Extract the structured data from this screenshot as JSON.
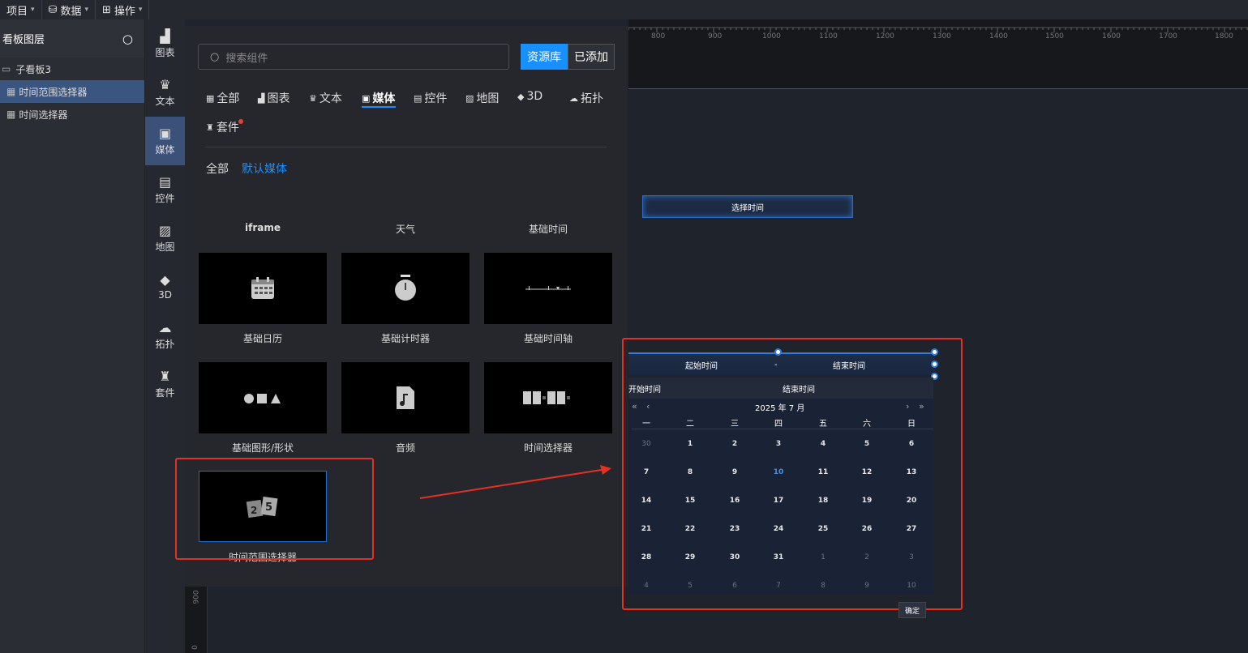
{
  "menu": [
    {
      "label": "项目",
      "icon": "none"
    },
    {
      "label": "数据",
      "icon": "database-icon"
    },
    {
      "label": "操作",
      "icon": "grid-icon"
    }
  ],
  "layers": {
    "title": "看板图层",
    "board": "子看板3",
    "items": [
      {
        "label": "时间范围选择器",
        "selected": true
      },
      {
        "label": "时间选择器",
        "selected": false
      }
    ]
  },
  "categories": [
    {
      "label": "图表",
      "icon": "chart-icon"
    },
    {
      "label": "文本",
      "icon": "crown-icon"
    },
    {
      "label": "媒体",
      "icon": "media-icon",
      "active": true
    },
    {
      "label": "控件",
      "icon": "control-icon"
    },
    {
      "label": "地图",
      "icon": "map-icon"
    },
    {
      "label": "3D",
      "icon": "cube-icon"
    },
    {
      "label": "拓扑",
      "icon": "topology-icon"
    },
    {
      "label": "套件",
      "icon": "shirt-icon"
    }
  ],
  "search": {
    "placeholder": "搜索组件"
  },
  "buttons": {
    "library": "资源库",
    "added": "已添加",
    "ok": "确定"
  },
  "tabs": [
    "全部",
    "图表",
    "文本",
    "媒体",
    "控件",
    "地图",
    "3D",
    "拓扑",
    "套件"
  ],
  "subtabs": [
    "全部",
    "默认媒体"
  ],
  "components": {
    "top_row": [
      "iframe",
      "天气",
      "基础时间"
    ],
    "cards": [
      "基础日历",
      "基础计时器",
      "基础时间轴",
      "基础图形/形状",
      "音频",
      "时间选择器",
      "时间范围选择器"
    ]
  },
  "ruler": {
    "top": [
      "800",
      "900",
      "1000",
      "1100",
      "1200",
      "1300",
      "1400",
      "1500",
      "1600",
      "1700",
      "1800"
    ],
    "left": [
      "900",
      "0"
    ]
  },
  "widgets": {
    "picker_label": "选择时间",
    "range_start": "起始时间",
    "range_sep": "-",
    "range_end": "结束时间"
  },
  "calendar": {
    "start_label": "开始时间",
    "end_label": "结束时间",
    "month": "2025 年 7 月",
    "prev_year": "«",
    "prev_month": "‹",
    "next_month": "›",
    "next_year": "»",
    "weekdays": [
      "一",
      "二",
      "三",
      "四",
      "五",
      "六",
      "日"
    ],
    "weeks": [
      [
        "30",
        "1",
        "2",
        "3",
        "4",
        "5",
        "6"
      ],
      [
        "7",
        "8",
        "9",
        "10",
        "11",
        "12",
        "13"
      ],
      [
        "14",
        "15",
        "16",
        "17",
        "18",
        "19",
        "20"
      ],
      [
        "21",
        "22",
        "23",
        "24",
        "25",
        "26",
        "27"
      ],
      [
        "28",
        "29",
        "30",
        "31",
        "1",
        "2",
        "3"
      ],
      [
        "4",
        "5",
        "6",
        "7",
        "8",
        "9",
        "10"
      ]
    ],
    "today": "10"
  },
  "colors": {
    "accent": "#1890ff",
    "highlight": "#e53024",
    "selected_layer": "#3a5580"
  }
}
